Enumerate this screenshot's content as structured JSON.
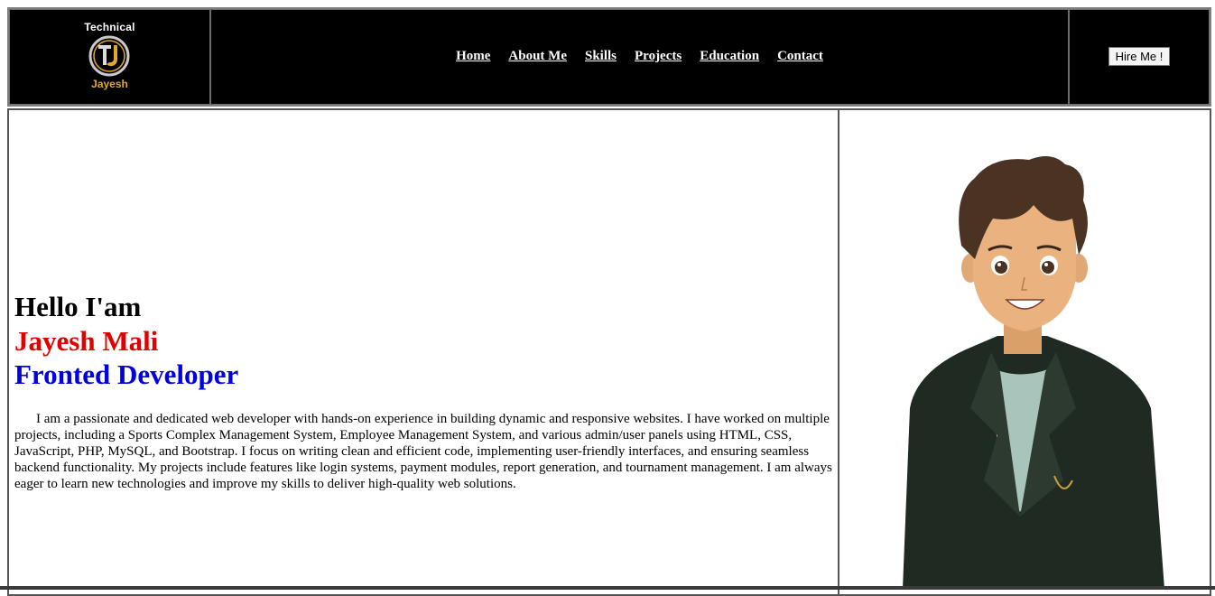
{
  "header": {
    "logo_top": "Technical",
    "logo_bottom": "Jayesh",
    "nav": [
      "Home",
      "About Me",
      "Skills",
      "Projects",
      "Education",
      "Contact"
    ],
    "hire_label": "Hire Me !"
  },
  "hero": {
    "greeting": "Hello I'am",
    "name": "Jayesh Mali",
    "role": "Fronted Developer",
    "bio": "I am a passionate and dedicated web developer with hands-on experience in building dynamic and responsive websites. I have worked on multiple projects, including a Sports Complex Management System, Employee Management System, and various admin/user panels using HTML, CSS, JavaScript, PHP, MySQL, and Bootstrap. I focus on writing clean and efficient code, implementing user-friendly interfaces, and ensuring seamless backend functionality. My projects include features like login systems, payment modules, report generation, and tournament management. I am always eager to learn new technologies and improve my skills to deliver high-quality web solutions."
  },
  "colors": {
    "nav_bg": "#000000",
    "logo_gold": "#e0a92a",
    "name_red": "#e00000",
    "role_blue": "#0000e0"
  }
}
